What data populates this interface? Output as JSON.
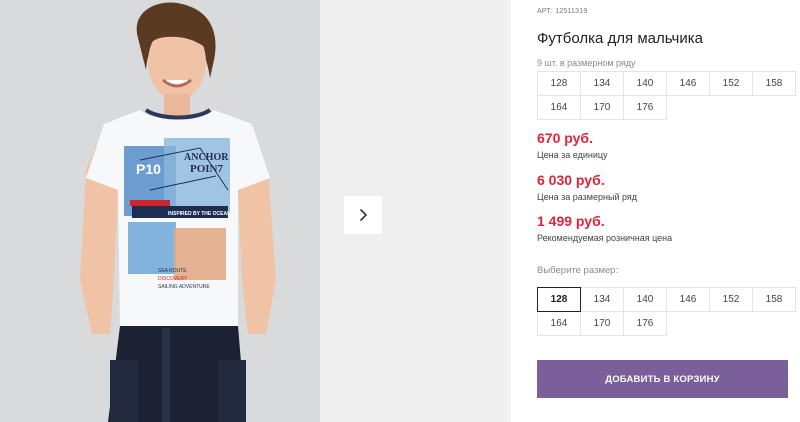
{
  "product": {
    "article": "АРТ: 12511319",
    "title": "Футболка для мальчика",
    "set_note": "9 шт. в размерном ряду",
    "set_sizes_row1": [
      "128",
      "134",
      "140",
      "146",
      "152",
      "158"
    ],
    "set_sizes_row2": [
      "164",
      "170",
      "176"
    ]
  },
  "prices": {
    "unit_price": "670 руб.",
    "unit_label": "Цена за единицу",
    "set_price": "6 030 руб.",
    "set_label": "Цена за размерный ряд",
    "retail_price": "1 499 руб.",
    "retail_label": "Рекомендуемая розничная цена"
  },
  "size_picker": {
    "label": "Выберите размер:",
    "sizes_row1": [
      "128",
      "134",
      "140",
      "146",
      "152",
      "158"
    ],
    "sizes_row2": [
      "164",
      "170",
      "176"
    ],
    "selected": "128"
  },
  "gallery": {
    "shirt_text_1": "ANCHOR",
    "shirt_text_2": "POIN7",
    "shirt_text_3": "INSPIRED BY THE OCEAN",
    "shirt_text_4": "SEA ROUTE",
    "shirt_text_5": "DISCOVERY",
    "shirt_text_6": "SAILING ADVENTURE",
    "shirt_text_7": "P10",
    "next_icon": "chevron-right-icon"
  },
  "actions": {
    "add_to_cart": "ДОБАВИТЬ В КОРЗИНУ"
  },
  "colors": {
    "price_red": "#e0233c",
    "button_purple": "#7a5f9a"
  }
}
